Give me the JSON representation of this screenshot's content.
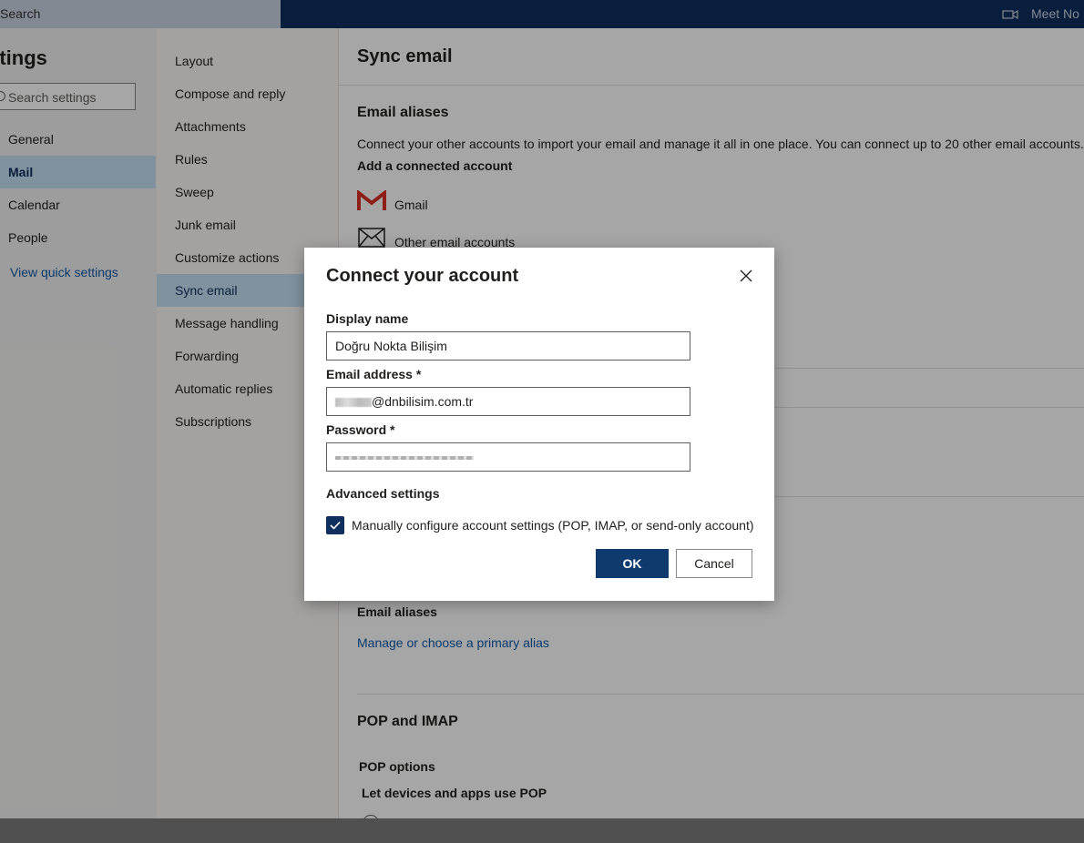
{
  "topbar": {
    "search_label": "Search",
    "meet_label": "Meet No"
  },
  "settings_nav": {
    "title": "ttings",
    "search_placeholder": "Search settings",
    "items": [
      {
        "label": "General"
      },
      {
        "label": "Mail"
      },
      {
        "label": "Calendar"
      },
      {
        "label": "People"
      }
    ],
    "quick_link": "View quick settings"
  },
  "mail_nav": {
    "items": [
      {
        "label": "Layout"
      },
      {
        "label": "Compose and reply"
      },
      {
        "label": "Attachments"
      },
      {
        "label": "Rules"
      },
      {
        "label": "Sweep"
      },
      {
        "label": "Junk email"
      },
      {
        "label": "Customize actions"
      },
      {
        "label": "Sync email"
      },
      {
        "label": "Message handling"
      },
      {
        "label": "Forwarding"
      },
      {
        "label": "Automatic replies"
      },
      {
        "label": "Subscriptions"
      }
    ]
  },
  "main": {
    "title": "Sync email",
    "section1_title": "Email aliases",
    "description": "Connect your other accounts to import your email and manage it all in one place. You can connect up to 20 other email accounts.",
    "add_account": "Add a connected account",
    "gmail": "Gmail",
    "other_accounts": "Other email accounts",
    "aliases_label": "Email aliases",
    "manage_alias": "Manage or choose a primary alias",
    "pop_title": "POP and IMAP",
    "pop_options": "POP options",
    "let_devices": "Let devices and apps use POP"
  },
  "dialog": {
    "title": "Connect your account",
    "display_name_label": "Display name",
    "display_name_value": "Doğru Nokta Bilişim",
    "email_label": "Email address *",
    "email_value": "@dnbilisim.com.tr",
    "password_label": "Password *",
    "advanced_label": "Advanced settings",
    "manual_config_label": "Manually configure account settings (POP, IMAP, or send-only account)",
    "manual_config_checked": true,
    "ok_label": "OK",
    "cancel_label": "Cancel"
  },
  "colors": {
    "accent": "#0f2f5e",
    "link": "#0f5aa8",
    "nav_selected": "#c7e0f4"
  }
}
